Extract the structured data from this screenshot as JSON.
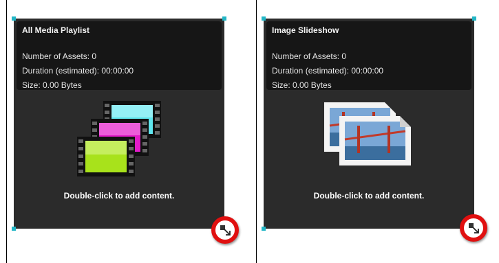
{
  "widgets": [
    {
      "title": "All Media Playlist",
      "assets": "Number of Assets: 0",
      "duration": "Duration (estimated): 00:00:00",
      "size": "Size: 0.00 Bytes",
      "hint": "Double-click to add content.",
      "icon": "film-strips-icon"
    },
    {
      "title": "Image Slideshow",
      "assets": "Number of Assets: 0",
      "duration": "Duration (estimated): 00:00:00",
      "size": "Size: 0.00 Bytes",
      "hint": "Double-click to add content.",
      "icon": "photo-stack-icon"
    }
  ],
  "colors": {
    "handle": "#22b6c6",
    "widget_bg": "#2b2b2b",
    "info_bg": "#161616",
    "highlight_ring": "#e01010"
  }
}
